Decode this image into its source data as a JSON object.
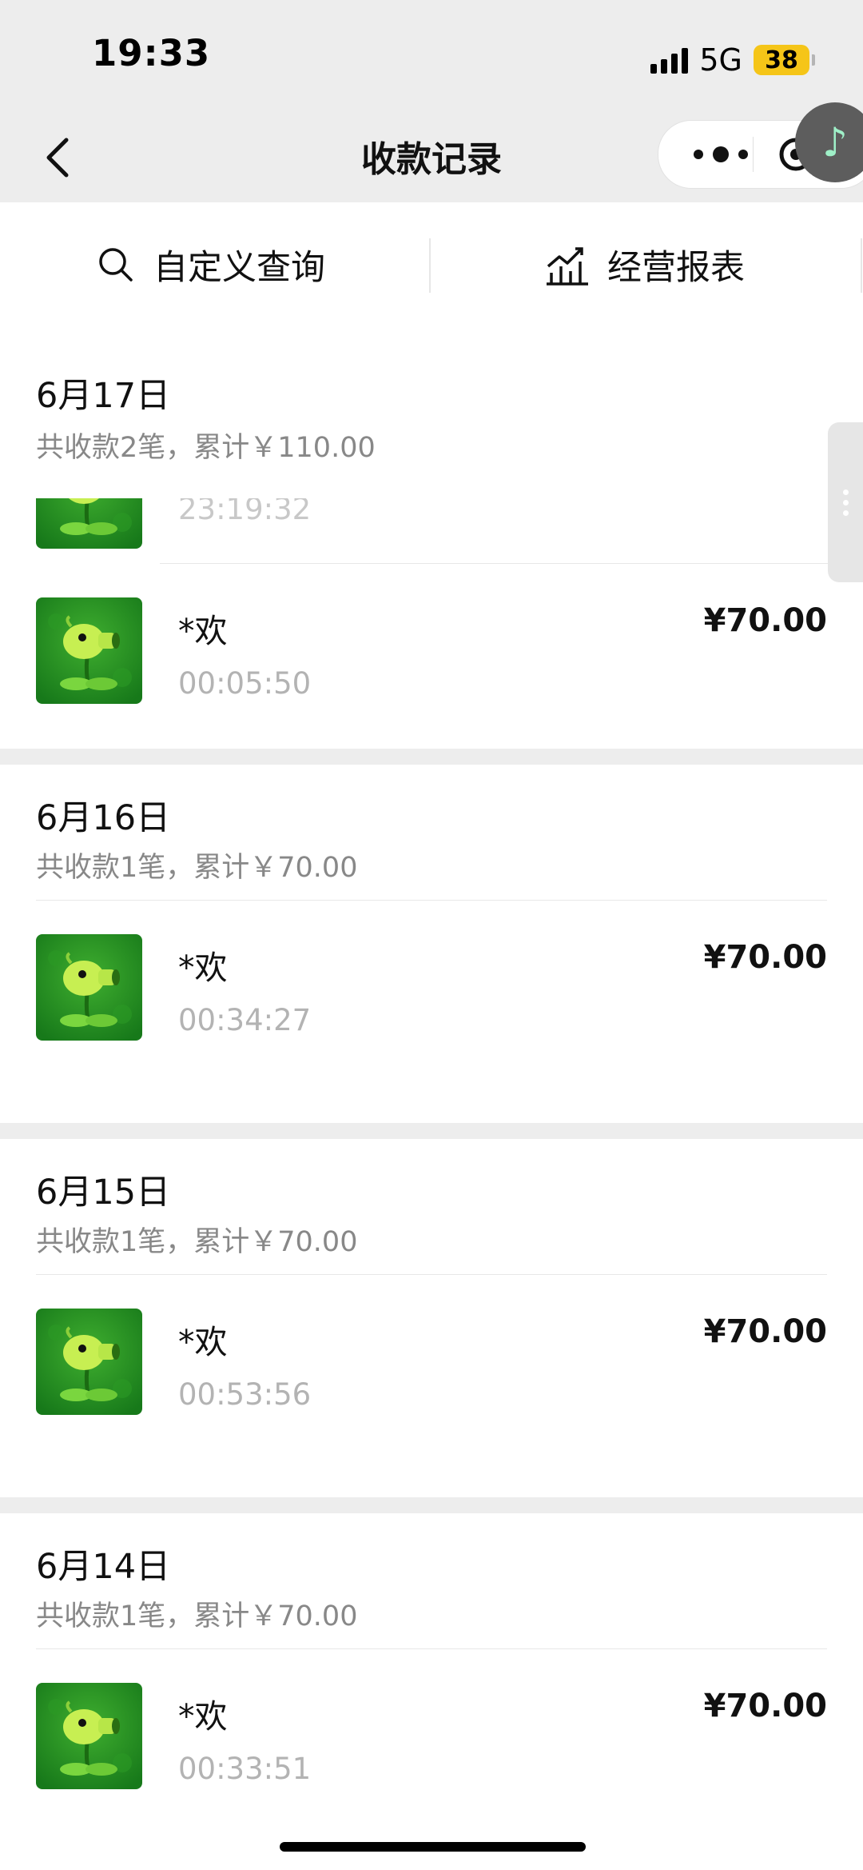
{
  "status_bar": {
    "time": "19:33",
    "network": "5G",
    "battery": "38"
  },
  "nav": {
    "title": "收款记录"
  },
  "filters": {
    "custom_query": "自定义查询",
    "business_report": "经营报表"
  },
  "colors": {
    "bg_gray": "#ededed",
    "text_secondary": "#888888",
    "text_time": "#b3b3b3",
    "battery": "#f5c518"
  },
  "groups": [
    {
      "date": "6月17日",
      "summary": "共收款2笔，累计￥110.00",
      "partial_time": "23:19:32",
      "rows": [
        {
          "name": "*欢",
          "time": "00:05:50",
          "amount": "¥70.00"
        }
      ]
    },
    {
      "date": "6月16日",
      "summary": "共收款1笔，累计￥70.00",
      "rows": [
        {
          "name": "*欢",
          "time": "00:34:27",
          "amount": "¥70.00"
        }
      ]
    },
    {
      "date": "6月15日",
      "summary": "共收款1笔，累计￥70.00",
      "rows": [
        {
          "name": "*欢",
          "time": "00:53:56",
          "amount": "¥70.00"
        }
      ]
    },
    {
      "date": "6月14日",
      "summary": "共收款1笔，累计￥70.00",
      "rows": [
        {
          "name": "*欢",
          "time": "00:33:51",
          "amount": "¥70.00"
        }
      ]
    }
  ],
  "icons": [
    "back-icon",
    "more-dots-icon",
    "target-icon",
    "music-note-icon",
    "search-icon",
    "chart-icon",
    "peashooter-avatar"
  ]
}
